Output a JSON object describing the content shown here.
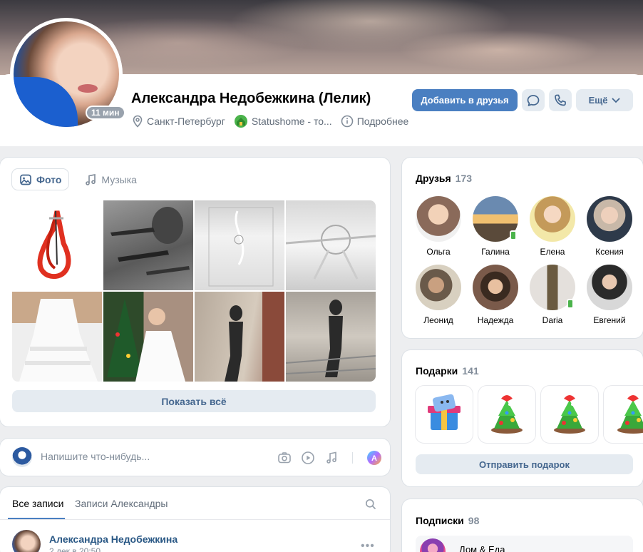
{
  "profile": {
    "name": "Александра Недобежкина (Лелик)",
    "online": "11 мин",
    "city": "Санкт-Петербург",
    "status_app": "Statushome - то...",
    "details": "Подробнее"
  },
  "actions": {
    "add_friend": "Добавить в друзья",
    "more": "Ещё"
  },
  "media": {
    "tabs": [
      {
        "label": "Фото",
        "icon": "image-icon"
      },
      {
        "label": "Музыка",
        "icon": "music-note-icon"
      }
    ],
    "show_all": "Показать всё"
  },
  "composer": {
    "placeholder": "Напишите что-нибудь..."
  },
  "wall": {
    "tabs": [
      "Все записи",
      "Записи Александры"
    ],
    "post": {
      "author": "Александра Недобежкина",
      "date": "2 дек в 20:50"
    }
  },
  "friends": {
    "title": "Друзья",
    "count": "173",
    "items": [
      {
        "name": "Ольга",
        "mobile": false,
        "color": "#8a6a5a"
      },
      {
        "name": "Галина",
        "mobile": true,
        "color": "#d9a05a"
      },
      {
        "name": "Елена",
        "mobile": false,
        "color": "#e8c88a"
      },
      {
        "name": "Ксения",
        "mobile": false,
        "color": "#5a6a80"
      },
      {
        "name": "Леонид",
        "mobile": false,
        "color": "#a08a70"
      },
      {
        "name": "Надежда",
        "mobile": false,
        "color": "#6a4a3a"
      },
      {
        "name": "Daria",
        "mobile": true,
        "color": "#c8c0b8"
      },
      {
        "name": "Евгений",
        "mobile": false,
        "color": "#7a7a7a"
      }
    ]
  },
  "gifts": {
    "title": "Подарки",
    "count": "141",
    "send": "Отправить подарок"
  },
  "subscriptions": {
    "title": "Подписки",
    "count": "98",
    "first": "Дом & Еда"
  },
  "colors": {
    "accent": "#4a7fc1",
    "link": "#2a5885",
    "secondary_button": "#e5ebf1"
  }
}
